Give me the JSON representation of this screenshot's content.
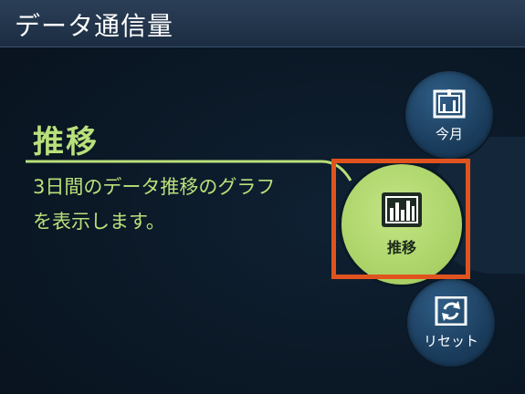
{
  "header": {
    "title": "データ通信量"
  },
  "main": {
    "heading": "推移",
    "description_line1": "3日間のデータ推移のグラフ",
    "description_line2": "を表示します。"
  },
  "buttons": {
    "month_label": "今月",
    "trend_label": "推移",
    "reset_label": "リセット"
  },
  "colors": {
    "accent": "#b9e07a",
    "highlight": "#e0531e",
    "button_blue": "#1b3d5d",
    "title_bar": "#2b3f57"
  },
  "icons": {
    "month": "calendar-icon",
    "trend": "bar-chart-icon",
    "reset": "refresh-icon"
  }
}
